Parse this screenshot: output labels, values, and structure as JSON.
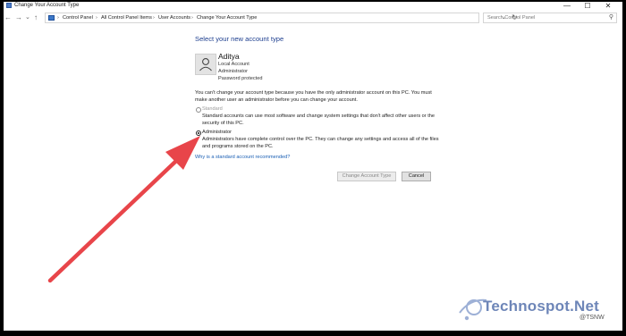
{
  "window": {
    "title": "Change Your Account Type",
    "controls": {
      "minimize": "—",
      "maximize": "☐",
      "close": "✕"
    }
  },
  "address_bar": {
    "back_icon": "←",
    "forward_icon": "→",
    "dropdown_icon": "⌄",
    "up_icon": "↑",
    "breadcrumbs": [
      "Control Panel",
      "All Control Panel Items",
      "User Accounts",
      "Change Your Account Type"
    ],
    "separator": "›",
    "refresh_icon": "↻"
  },
  "search": {
    "placeholder": "Search Control Panel",
    "icon": "⚲"
  },
  "main": {
    "heading": "Select your new account type",
    "user": {
      "name": "Aditya",
      "details": [
        "Local Account",
        "Administrator",
        "Password protected"
      ]
    },
    "notice_line1": "You can't change your account type because you have the only administrator account on this PC. You must",
    "notice_line2": "make another user an administrator before you can change your account.",
    "options": [
      {
        "label": "Standard",
        "selected": false,
        "disabled": true,
        "description_line1": "Standard accounts can use most software and change system settings that don't affect other users or the",
        "description_line2": "security of this PC."
      },
      {
        "label": "Administrator",
        "selected": true,
        "disabled": false,
        "description_line1": "Administrators have complete control over the PC. They can change any settings and access all of the files",
        "description_line2": "and programs stored on the PC."
      }
    ],
    "help_link": "Why is a standard account recommended?",
    "buttons": {
      "change": "Change Account Type",
      "cancel": "Cancel"
    }
  },
  "annotation": {
    "arrow_color": "#e8454a"
  },
  "watermark": {
    "text": "Technospot.Net",
    "sub": "@TSNW"
  }
}
